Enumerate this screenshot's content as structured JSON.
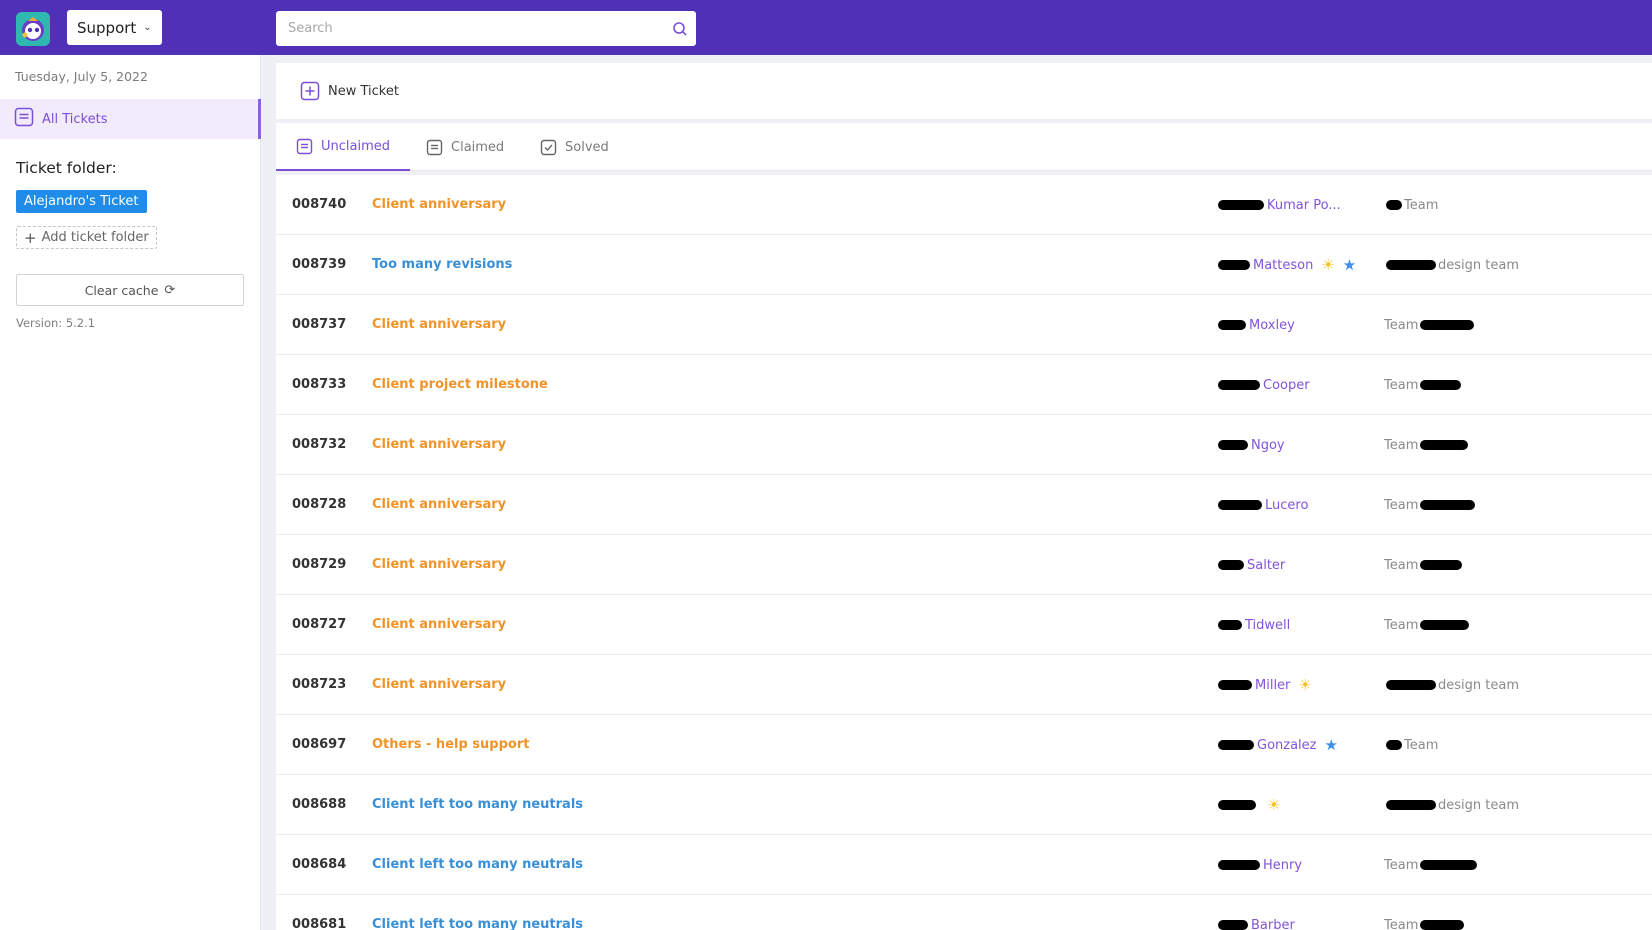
{
  "header": {
    "workspace_label": "Support",
    "search": {
      "placeholder": "Search",
      "value": ""
    }
  },
  "sidebar": {
    "date": "Tuesday, July 5, 2022",
    "nav": {
      "all_tickets_label": "All Tickets"
    },
    "folder_heading": "Ticket folder:",
    "folders": [
      "Alejandro's Ticket"
    ],
    "add_folder_label": "Add ticket folder",
    "clear_cache_label": "Clear cache",
    "version": "Version: 5.2.1"
  },
  "main": {
    "new_ticket_label": "New Ticket",
    "tabs": [
      {
        "label": "Unclaimed",
        "active": true
      },
      {
        "label": "Claimed",
        "active": false
      },
      {
        "label": "Solved",
        "active": false
      }
    ]
  },
  "tickets": [
    {
      "id": "008740",
      "subject": "Client anniversary",
      "subject_color": "#f0942a",
      "assignee": "Kumar Po...",
      "badges": [],
      "team": "Team",
      "team_prefix_redacted": true,
      "team_suffix_redacted": false
    },
    {
      "id": "008739",
      "subject": "Too many revisions",
      "subject_color": "#3a8fd6",
      "assignee": "Matteson",
      "badges": [
        "sun-icon",
        "star-icon"
      ],
      "team": "design team",
      "team_prefix_redacted": true,
      "team_suffix_redacted": false
    },
    {
      "id": "008737",
      "subject": "Client anniversary",
      "subject_color": "#f0942a",
      "assignee": "Moxley",
      "badges": [],
      "team": "Team",
      "team_prefix_redacted": false,
      "team_suffix_redacted": true
    },
    {
      "id": "008733",
      "subject": "Client project milestone",
      "subject_color": "#f0942a",
      "assignee": "Cooper",
      "badges": [],
      "team": "Team",
      "team_prefix_redacted": false,
      "team_suffix_redacted": true
    },
    {
      "id": "008732",
      "subject": "Client anniversary",
      "subject_color": "#f0942a",
      "assignee": "Ngoy",
      "badges": [],
      "team": "Team",
      "team_prefix_redacted": false,
      "team_suffix_redacted": true
    },
    {
      "id": "008728",
      "subject": "Client anniversary",
      "subject_color": "#f0942a",
      "assignee": "Lucero",
      "badges": [],
      "team": "Team",
      "team_prefix_redacted": false,
      "team_suffix_redacted": true
    },
    {
      "id": "008729",
      "subject": "Client anniversary",
      "subject_color": "#f0942a",
      "assignee": "Salter",
      "badges": [],
      "team": "Team",
      "team_prefix_redacted": false,
      "team_suffix_redacted": true
    },
    {
      "id": "008727",
      "subject": "Client anniversary",
      "subject_color": "#f0942a",
      "assignee": "Tidwell",
      "badges": [],
      "team": "Team",
      "team_prefix_redacted": false,
      "team_suffix_redacted": true
    },
    {
      "id": "008723",
      "subject": "Client anniversary",
      "subject_color": "#f0942a",
      "assignee": "Miller",
      "badges": [
        "sun-icon"
      ],
      "team": "design team",
      "team_prefix_redacted": true,
      "team_suffix_redacted": false
    },
    {
      "id": "008697",
      "subject": "Others - help support",
      "subject_color": "#f0942a",
      "assignee": "Gonzalez",
      "badges": [
        "star-icon"
      ],
      "team": "Team",
      "team_prefix_redacted": true,
      "team_suffix_redacted": false
    },
    {
      "id": "008688",
      "subject": "Client left too many neutrals",
      "subject_color": "#3a8fd6",
      "assignee": "",
      "badges": [
        "sun-icon"
      ],
      "team": "design team",
      "team_prefix_redacted": true,
      "team_suffix_redacted": false
    },
    {
      "id": "008684",
      "subject": "Client left too many neutrals",
      "subject_color": "#3a8fd6",
      "assignee": "Henry",
      "badges": [],
      "team": "Team",
      "team_prefix_redacted": false,
      "team_suffix_redacted": true
    },
    {
      "id": "008681",
      "subject": "Client left too many neutrals",
      "subject_color": "#3a8fd6",
      "assignee": "Barber",
      "badges": [],
      "team": "Team",
      "team_prefix_redacted": false,
      "team_suffix_redacted": true
    }
  ],
  "colors": {
    "brand": "#5130b8",
    "accent": "#7a4fd6",
    "folder_tag": "#1e8ce8",
    "subject_orange": "#f0942a",
    "subject_blue": "#3a8fd6"
  }
}
